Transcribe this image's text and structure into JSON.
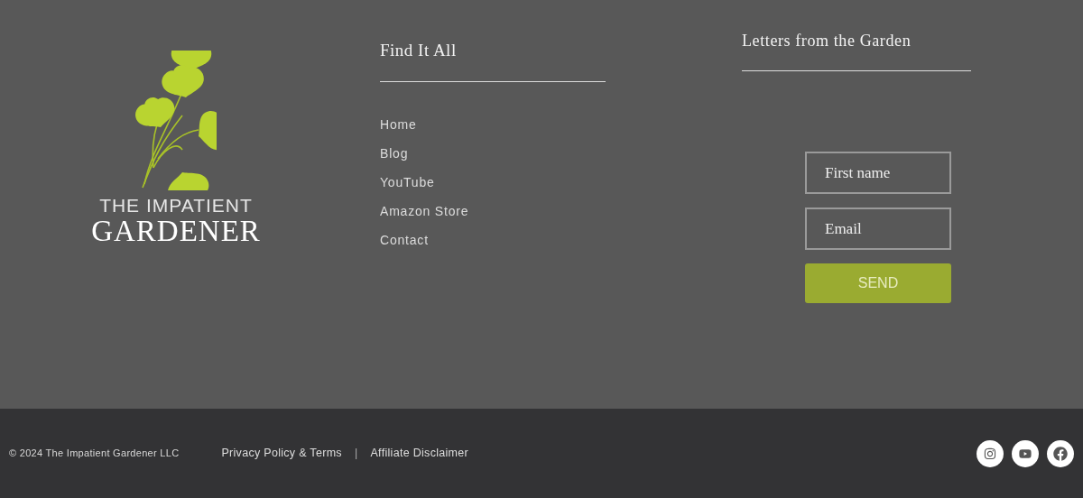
{
  "logo": {
    "line_1": "THE IMPATIENT",
    "line_2": "GARDENER"
  },
  "nav": {
    "title": "Find It All",
    "links": [
      "Home",
      "Blog",
      "YouTube",
      "Amazon Store",
      "Contact"
    ]
  },
  "newsletter": {
    "title": "Letters from the Garden",
    "fields": [
      {
        "placeholder": "First name"
      },
      {
        "placeholder": "Email"
      }
    ],
    "button": "SEND"
  },
  "bottom_bar": {
    "copyright": "© 2024 The Impatient Gardener LLC",
    "links": [
      "Privacy Policy & Terms",
      "Affiliate Disclaimer"
    ],
    "separator": "|",
    "social": [
      {
        "kind": "instagram"
      },
      {
        "kind": "youtube"
      },
      {
        "kind": "facebook"
      }
    ]
  }
}
